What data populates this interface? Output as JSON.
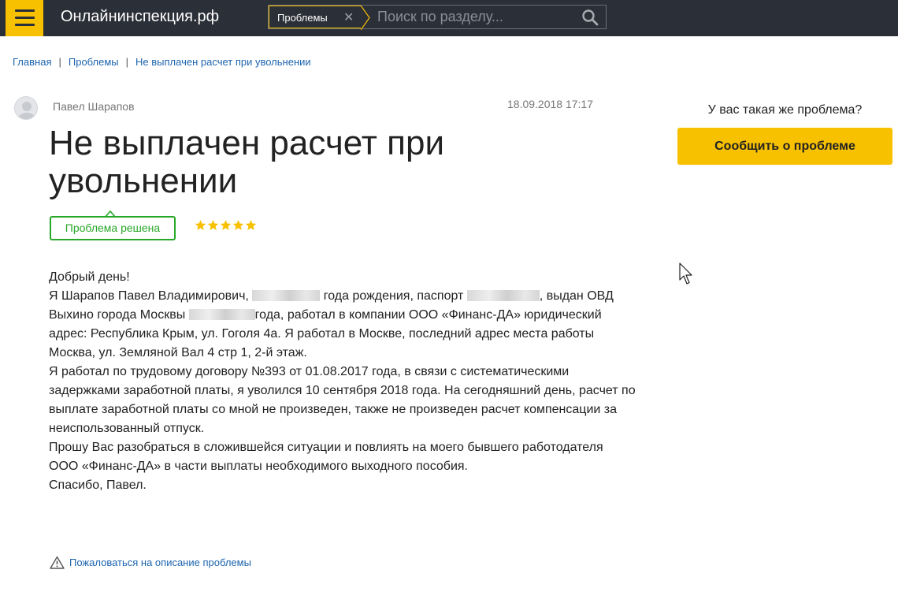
{
  "header": {
    "site_title": "Онлайнинспекция.рф",
    "search_tag": "Проблемы",
    "search_placeholder": "Поиск по разделу..."
  },
  "breadcrumbs": [
    {
      "label": "Главная"
    },
    {
      "label": "Проблемы"
    },
    {
      "label": "Не выплачен расчет при увольнении"
    }
  ],
  "post": {
    "author": "Павел Шарапов",
    "date": "18.09.2018 17:17",
    "title": "Не выплачен расчет при увольнении",
    "status": "Проблема решена",
    "rating": 5,
    "body": {
      "greeting": "Добрый день!",
      "p1_a": "Я Шарапов Павел Владимирович, ",
      "p1_b": " года рождения, паспорт ",
      "p1_c": ", выдан ОВД Выхино города Москвы ",
      "p1_d": "года, работал в компании ООО «Финанс-ДА» юридический адрес: Республика Крым, ул. Гоголя 4а. Я работал в Москве, последний адрес места работы Москва, ул. Земляной Вал 4 стр 1, 2-й этаж.",
      "p2": "Я работал по трудовому договору №393 от 01.08.2017 года, в связи с систематическими задержками заработной платы, я уволился 10 сентября 2018 года. На сегодняшний день, расчет по выплате заработной платы со мной не произведен, также не произведен расчет компенсации за неиспользованный отпуск.",
      "p3": "Прошу Вас разобраться в сложившейся ситуации и повлиять на моего бывшего работодателя ООО «Финанс-ДА» в части выплаты необходимого выходного пособия.",
      "signoff": "Спасибо, Павел."
    },
    "complaint_link": "Пожаловаться на описание проблемы"
  },
  "sidebar": {
    "question": "У вас такая же проблема?",
    "report_button": "Сообщить о проблеме"
  },
  "colors": {
    "accent": "#f8c100",
    "header_bg": "#2b2f37",
    "link": "#1d64ae",
    "success": "#28a828"
  }
}
